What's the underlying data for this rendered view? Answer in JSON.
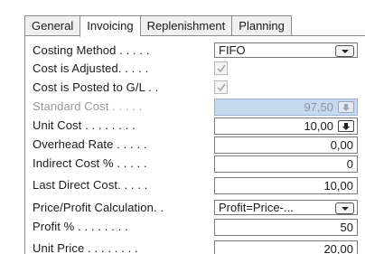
{
  "tabs": [
    {
      "label": "General"
    },
    {
      "label": "Invoicing"
    },
    {
      "label": "Replenishment"
    },
    {
      "label": "Planning"
    }
  ],
  "fields": {
    "costing_method": {
      "label": "Costing Method . . . . .",
      "value": "FIFO"
    },
    "cost_is_adjusted": {
      "label": "Cost is Adjusted. . . . .",
      "checked": true
    },
    "cost_posted_gl": {
      "label": "Cost is Posted to G/L . .",
      "checked": true
    },
    "standard_cost": {
      "label": "Standard Cost . . . . .",
      "value": "97,50"
    },
    "unit_cost": {
      "label": "Unit Cost . . . . . . . .",
      "value": "10,00"
    },
    "overhead_rate": {
      "label": "Overhead Rate . . . . .",
      "value": "0,00"
    },
    "indirect_cost": {
      "label": "Indirect Cost % . . . . .",
      "value": "0"
    },
    "last_direct_cost": {
      "label": "Last Direct Cost. . . . .",
      "value": "10,00"
    },
    "price_profit_calc": {
      "label": "Price/Profit Calculation. .",
      "value": "Profit=Price-..."
    },
    "profit_pct": {
      "label": "Profit % . . . . . . . .",
      "value": "50"
    },
    "unit_price": {
      "label": "Unit Price . . . . . . . .",
      "value": "20,00"
    }
  },
  "colors": {
    "shaded_field": "#c7d9ef",
    "border": "#7a7a7a"
  },
  "icons": {
    "dropdown": "chevron-down-icon",
    "lookup": "arrow-down-icon",
    "check": "check-icon"
  }
}
